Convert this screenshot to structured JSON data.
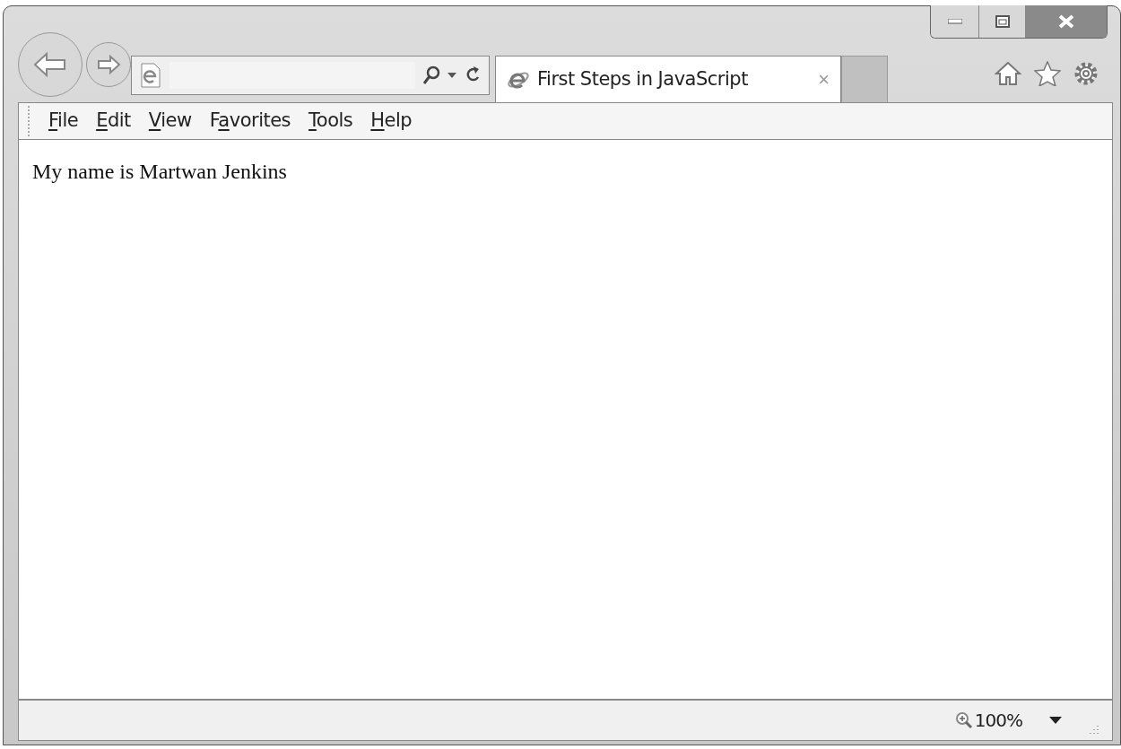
{
  "tabs": [
    {
      "label": "First Steps in JavaScript",
      "selected": true,
      "close": "×"
    }
  ],
  "menu": [
    {
      "access_key": "F",
      "rest": "ile"
    },
    {
      "access_key": "E",
      "rest": "dit"
    },
    {
      "access_key": "V",
      "rest": "iew"
    },
    {
      "lead": "F",
      "access_key": "a",
      "rest": "vorites"
    },
    {
      "access_key": "T",
      "rest": "ools"
    },
    {
      "access_key": "H",
      "rest": "elp"
    }
  ],
  "content": {
    "text": "My name is Martwan Jenkins"
  },
  "status_bar": {
    "zoom": "100%"
  }
}
